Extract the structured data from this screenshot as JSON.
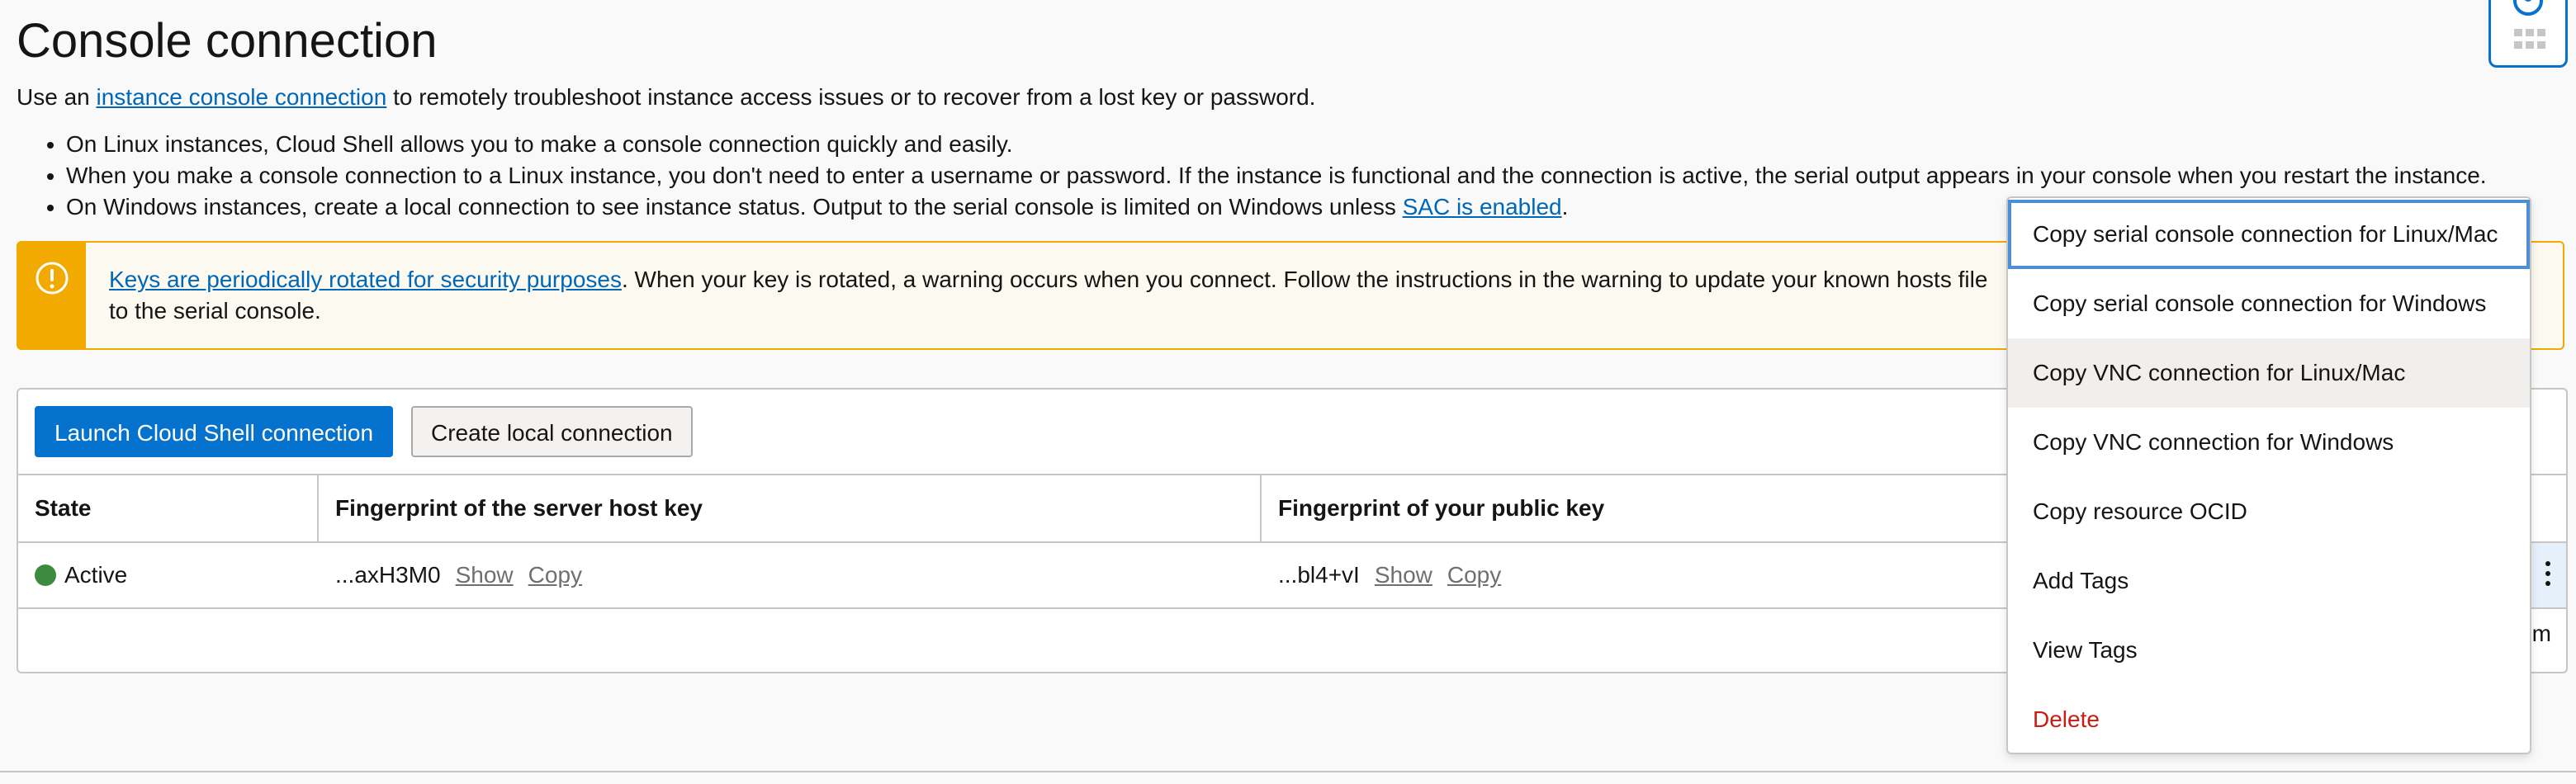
{
  "page": {
    "title": "Console connection",
    "intro_before": "Use an ",
    "intro_link": "instance console connection",
    "intro_after": " to remotely troubleshoot instance access issues or to recover from a lost key or password.",
    "bullets": [
      "On Linux instances, Cloud Shell allows you to make a console connection quickly and easily.",
      "When you make a console connection to a Linux instance, you don't need to enter a username or password. If the instance is functional and the connection is active, the serial output appears in your console when you restart the instance."
    ],
    "bullet3_before": "On Windows instances, create a local connection to see instance status. Output to the serial console is limited on Windows unless ",
    "bullet3_link": "SAC is enabled",
    "bullet3_after": "."
  },
  "alert": {
    "link": "Keys are periodically rotated for security purposes",
    "text": ". When your key is rotated, a warning occurs when you connect. Follow the instructions in the warning to update your known hosts file",
    "text2": "to the serial console.",
    "icon": "warning-icon",
    "color": "#f2a900"
  },
  "toolbar": {
    "launch_label": "Launch Cloud Shell connection",
    "create_label": "Create local connection"
  },
  "table": {
    "columns": [
      "State",
      "Fingerprint of the server host key",
      "Fingerprint of your public key"
    ],
    "rows": [
      {
        "state": "Active",
        "server_fp": "...axH3M0",
        "public_fp": "...bl4+vI",
        "show_label": "Show",
        "copy_label": "Copy"
      }
    ],
    "footer_partial": "m"
  },
  "menu": {
    "items": [
      "Copy serial console connection for Linux/Mac",
      "Copy serial console connection for Windows",
      "Copy VNC connection for Linux/Mac",
      "Copy VNC connection for Windows",
      "Copy resource OCID",
      "Add Tags",
      "View Tags",
      "Delete"
    ]
  },
  "colors": {
    "primary": "#0572ce",
    "active_status": "#3e8a3e",
    "danger": "#c81d14"
  }
}
